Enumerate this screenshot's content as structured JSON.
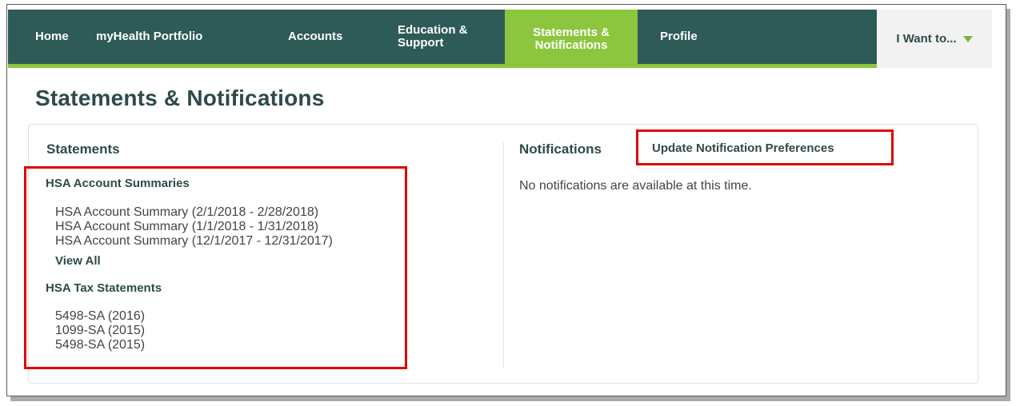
{
  "nav": {
    "home": "Home",
    "portfolio": "myHealth Portfolio",
    "accounts": "Accounts",
    "education": "Education & Support",
    "statements": "Statements & Notifications",
    "profile": "Profile",
    "want_to": "I Want to..."
  },
  "page": {
    "title": "Statements & Notifications"
  },
  "statements": {
    "heading": "Statements",
    "account_summaries": {
      "heading": "HSA Account Summaries",
      "items": [
        "HSA Account Summary (2/1/2018 - 2/28/2018)",
        "HSA Account Summary (1/1/2018 - 1/31/2018)",
        "HSA Account Summary (12/1/2017 - 12/31/2017)"
      ],
      "view_all": "View All"
    },
    "tax_statements": {
      "heading": "HSA Tax Statements",
      "items": [
        "5498-SA (2016)",
        "1099-SA (2015)",
        "5498-SA (2015)"
      ]
    }
  },
  "notifications": {
    "heading": "Notifications",
    "update_link": "Update Notification Preferences",
    "empty_message": "No notifications are available at this time."
  },
  "colors": {
    "nav_bg": "#2e5a57",
    "accent_green": "#8cc63f",
    "heading_text": "#2e4a4a",
    "annotation_red": "#e00000"
  }
}
